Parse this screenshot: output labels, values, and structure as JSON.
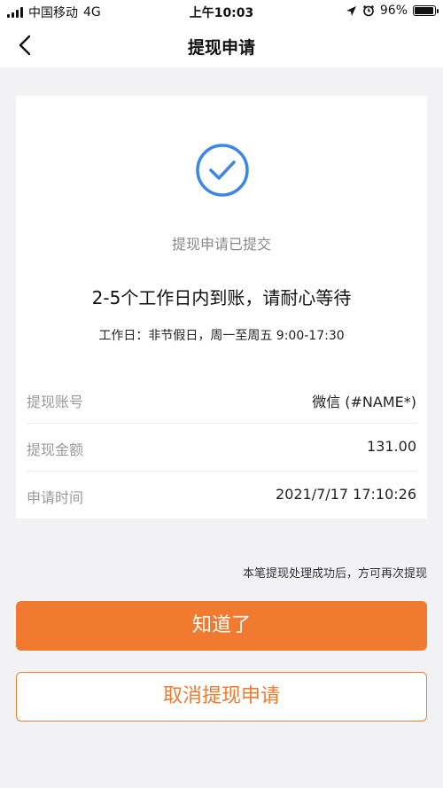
{
  "status_bar": {
    "carrier": "中国移动",
    "network": "4G",
    "time": "上午10:03",
    "battery": "96%",
    "battery_level": 0.96,
    "icons": [
      "signal-icon",
      "location-icon",
      "alarm-icon",
      "battery-icon"
    ]
  },
  "nav": {
    "title": "提现申请",
    "back_icon": "chevron-left-icon"
  },
  "result": {
    "icon": "check-circle-icon",
    "submitted": "提现申请已提交",
    "headline": "2-5个工作日内到账，请耐心等待",
    "workday": "工作日：非节假日，周一至周五 9:00-17:30"
  },
  "details": [
    {
      "label": "提现账号",
      "value": "微信 (#NAME*)"
    },
    {
      "label": "提现金额",
      "value": "131.00"
    },
    {
      "label": "申请时间",
      "value": "2021/7/17 17:10:26"
    }
  ],
  "note": "本笔提现处理成功后，方可再次提现",
  "buttons": {
    "confirm": "知道了",
    "cancel": "取消提现申请"
  },
  "colors": {
    "accent": "#f07a30",
    "check": "#3d86e8",
    "background": "#f2f2f4"
  }
}
